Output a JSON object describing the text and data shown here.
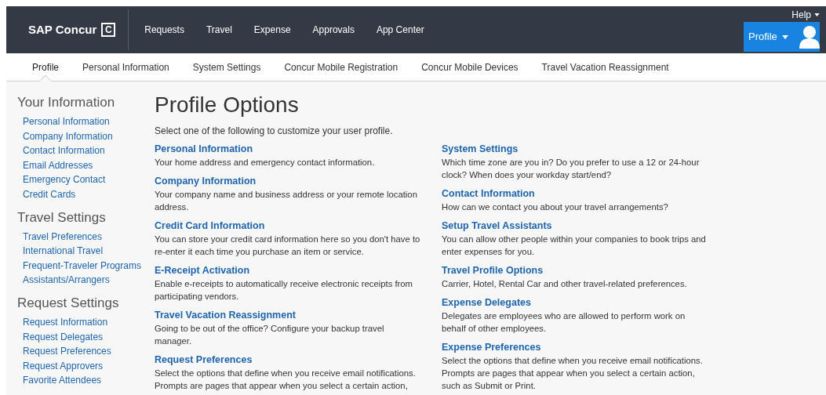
{
  "header": {
    "logo": "SAP Concur",
    "logo_mark": "C",
    "nav": [
      "Requests",
      "Travel",
      "Expense",
      "Approvals",
      "App Center"
    ],
    "help": "Help",
    "profile_button": "Profile"
  },
  "tabs": [
    {
      "label": "Profile",
      "selected": true
    },
    {
      "label": "Personal Information",
      "selected": false
    },
    {
      "label": "System Settings",
      "selected": false
    },
    {
      "label": "Concur Mobile Registration",
      "selected": false
    },
    {
      "label": "Concur Mobile Devices",
      "selected": false
    },
    {
      "label": "Travel Vacation Reassignment",
      "selected": false
    }
  ],
  "sidebar": [
    {
      "heading": "Your Information",
      "items": [
        "Personal Information",
        "Company Information",
        "Contact Information",
        "Email Addresses",
        "Emergency Contact",
        "Credit Cards"
      ]
    },
    {
      "heading": "Travel Settings",
      "items": [
        "Travel Preferences",
        "International Travel",
        "Frequent-Traveler Programs",
        "Assistants/Arrangers"
      ]
    },
    {
      "heading": "Request Settings",
      "items": [
        "Request Information",
        "Request Delegates",
        "Request Preferences",
        "Request Approvers",
        "Favorite Attendees"
      ]
    }
  ],
  "main": {
    "title": "Profile Options",
    "intro": "Select one of the following to customize your user profile.",
    "columns": [
      [
        {
          "title": "Personal Information",
          "description": "Your home address and emergency contact information."
        },
        {
          "title": "Company Information",
          "description": "Your company name and business address or your remote location address."
        },
        {
          "title": "Credit Card Information",
          "description": "You can store your credit card information here so you don't have to re-enter it each time you purchase an item or service."
        },
        {
          "title": "E-Receipt Activation",
          "description": "Enable e-receipts to automatically receive electronic receipts from participating vendors."
        },
        {
          "title": "Travel Vacation Reassignment",
          "description": "Going to be out of the office? Configure your backup travel manager."
        },
        {
          "title": "Request Preferences",
          "description": "Select the options that define when you receive email notifications. Prompts are pages that appear when you select a certain action,"
        }
      ],
      [
        {
          "title": "System Settings",
          "description": "Which time zone are you in? Do you prefer to use a 12 or 24-hour clock? When does your workday start/end?"
        },
        {
          "title": "Contact Information",
          "description": "How can we contact you about your travel arrangements?"
        },
        {
          "title": "Setup Travel Assistants",
          "description": "You can allow other people within your companies to book trips and enter expenses for you."
        },
        {
          "title": "Travel Profile Options",
          "description": "Carrier, Hotel, Rental Car and other travel-related preferences."
        },
        {
          "title": "Expense Delegates",
          "description": "Delegates are employees who are allowed to perform work on behalf of other employees."
        },
        {
          "title": "Expense Preferences",
          "description": "Select the options that define when you receive email notifications. Prompts are pages that appear when you select a certain action, such as Submit or Print."
        }
      ]
    ]
  }
}
